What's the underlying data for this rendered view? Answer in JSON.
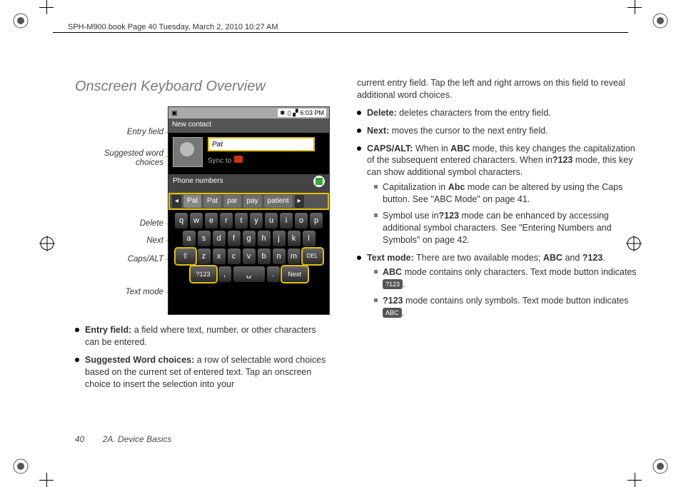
{
  "runhead": "SPH-M900.book  Page 40  Tuesday, March 2, 2010  10:27 AM",
  "section_title": "Onscreen Keyboard Overview",
  "figure": {
    "statusbar_time": "6:03 PM",
    "titlebar": "New contact",
    "entry_value": "Pat",
    "sync_label": "Sync to",
    "phone_numbers_label": "Phone numbers",
    "candidates": [
      "Pat",
      "Pat",
      "par",
      "pay",
      "patient"
    ],
    "rows": {
      "r1": [
        "q",
        "w",
        "e",
        "r",
        "t",
        "y",
        "u",
        "i",
        "o",
        "p"
      ],
      "r2": [
        "a",
        "s",
        "d",
        "f",
        "g",
        "h",
        "j",
        "k",
        "l"
      ],
      "r3_shift": "⇧",
      "r3": [
        "z",
        "x",
        "c",
        "v",
        "b",
        "n",
        "m"
      ],
      "r3_del": "DEL",
      "r4_mode": "?123",
      "r4_comma": ",",
      "r4_space": "␣",
      "r4_dot": ".",
      "r4_next": "Next"
    },
    "callouts": {
      "entry": "Entry field",
      "suggest": "Suggested word choices",
      "delete": "Delete",
      "next": "Next",
      "caps": "Caps/ALT",
      "mode": "Text mode"
    }
  },
  "left_bullets": {
    "entry": {
      "t": "Entry field:",
      "d": " a field where text, number, or other characters can be entered."
    },
    "suggest": {
      "t": "Suggested Word choices:",
      "d": " a row of selectable word choices based on the current set of entered text. Tap an onscreen choice to insert the selection into your"
    }
  },
  "right_intro": "current entry field. Tap the left and right arrows on this field to reveal additional word choices.",
  "right_bullets": {
    "del": {
      "t": "Delete:",
      "d": " deletes characters from the entry field."
    },
    "next": {
      "t": "Next:",
      "d": " moves the cursor to the next entry field."
    },
    "caps": {
      "t": "CAPS/ALT:",
      "d1": " When in ",
      "m1": "ABC",
      "d2": " mode, this key changes the capitalization of the subsequent entered characters. When in",
      "m2": "?123",
      "d3": " mode, this key can show additional symbol characters.",
      "sub1a": "Capitalization in ",
      "sub1b": "Abc",
      "sub1c": " mode can be altered by using the Caps button. See \"ABC Mode\" on page 41.",
      "sub2a": "Symbol use in",
      "sub2b": "?123",
      "sub2c": " mode can be enhanced by accessing additional symbol characters. See \"Entering Numbers and Symbols\" on page 42."
    },
    "mode": {
      "t": "Text mode:",
      "d1": " There are two available modes; ",
      "m1": "ABC",
      "d2": " and ",
      "m2": "?123",
      "d3": ".",
      "sub1a": "ABC",
      "sub1b": " mode contains only characters. Text mode button indicates ",
      "ind1": "?123",
      "sub1c": ".",
      "sub2a": "?123",
      "sub2b": " mode contains only symbols. Text mode button indicates ",
      "ind2": "ABC",
      "sub2c": "."
    }
  },
  "footer": {
    "page": "40",
    "chapter": "2A. Device Basics"
  }
}
